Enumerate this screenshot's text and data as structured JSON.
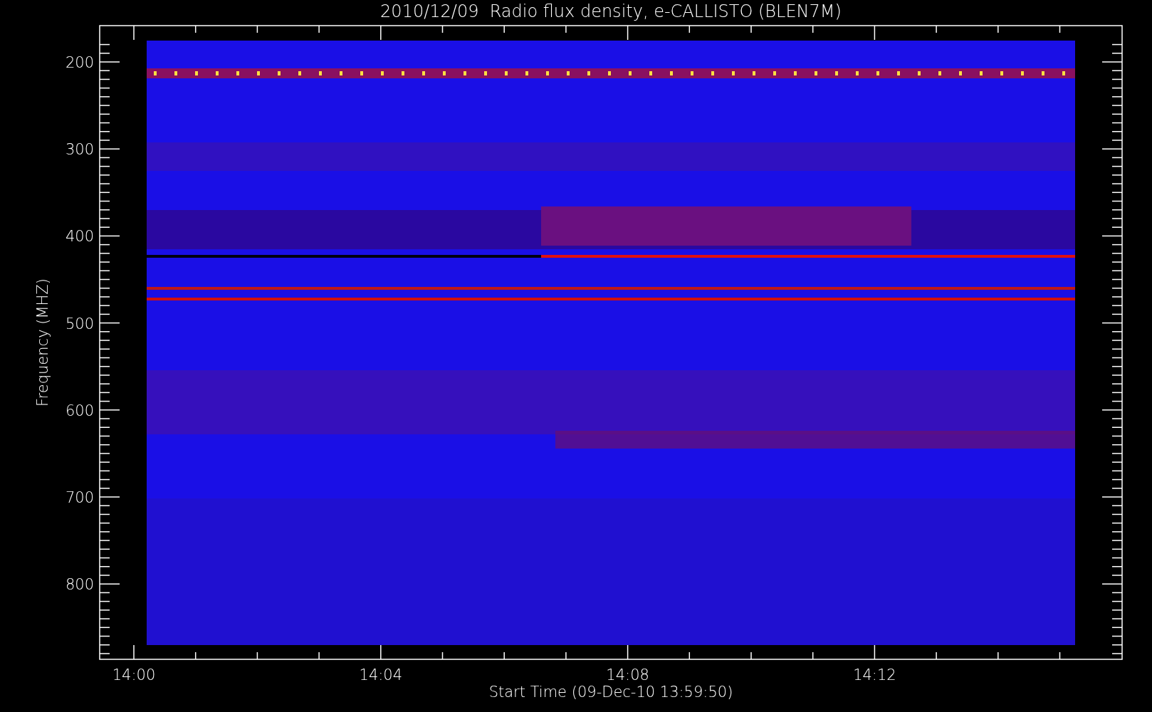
{
  "title": "2010/12/09  Radio flux density, e-CALLISTO (BLEN7M)",
  "y_axis": {
    "label": "Frequency (MHZ)",
    "ticks": [
      "200",
      "300",
      "400",
      "500",
      "600",
      "700",
      "800"
    ]
  },
  "x_axis": {
    "label": "Start Time (09-Dec-10 13:59:50)",
    "ticks": [
      "14:00",
      "14:04",
      "14:08",
      "14:12"
    ]
  }
}
